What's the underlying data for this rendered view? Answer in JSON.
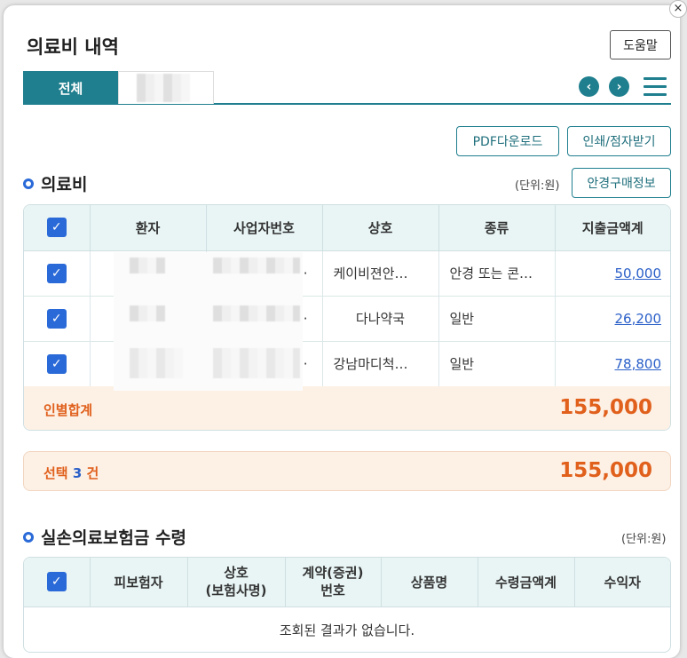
{
  "window": {
    "title": "의료비 내역",
    "close_label": "×",
    "help_label": "도움말"
  },
  "tabs": {
    "all": "전체"
  },
  "nav": {
    "prev": "‹",
    "next": "›"
  },
  "actions": {
    "pdf": "PDF다운로드",
    "print": "인쇄/점자받기",
    "glasses": "안경구매정보"
  },
  "medical": {
    "title": "의료비",
    "unit": "(단위:원)",
    "headers": [
      "환자",
      "사업자번호",
      "상호",
      "종류",
      "지출금액계"
    ],
    "rows": [
      {
        "name": "",
        "bizno": "·",
        "store": "케이비젼안…",
        "type": "안경 또는 콘…",
        "amount": "50,000"
      },
      {
        "name": "",
        "bizno": "·",
        "store": "다나약국",
        "type": "일반",
        "amount": "26,200"
      },
      {
        "name": "",
        "bizno": "·",
        "store": "강남마디척…",
        "type": "일반",
        "amount": "78,800"
      }
    ],
    "subtotal_label": "인별합계",
    "subtotal_value": "155,000"
  },
  "selection": {
    "prefix": "선택",
    "count": "3",
    "suffix": "건",
    "total": "155,000"
  },
  "insurance": {
    "title": "실손의료보험금 수령",
    "unit": "(단위:원)",
    "headers": [
      "피보험자",
      "상호\n(보험사명)",
      "계약(증권)\n번호",
      "상품명",
      "수령금액계",
      "수익자"
    ],
    "empty": "조회된 결과가 없습니다."
  },
  "colors": {
    "accent": "#1f7f8e",
    "checkbox": "#2a6ad8",
    "total": "#e0601c",
    "link": "#2a5fc8"
  },
  "icons": {
    "check": "✓"
  }
}
